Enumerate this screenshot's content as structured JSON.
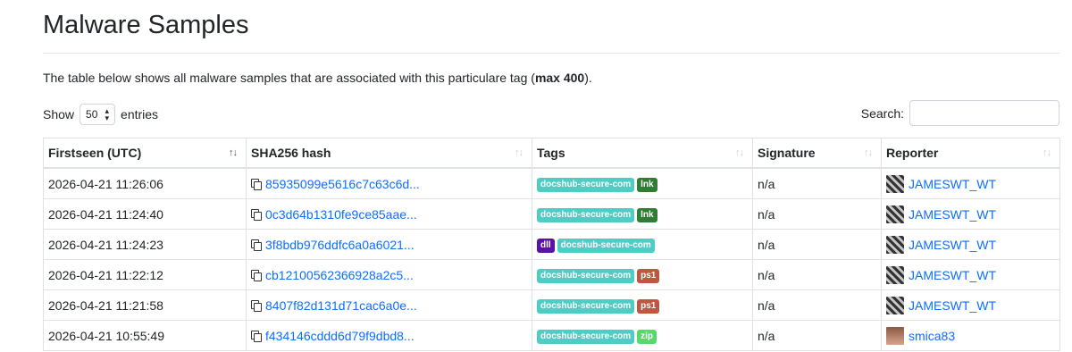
{
  "page": {
    "title": "Malware Samples",
    "intro_text": "The table below shows all malware samples that are associated with this particulare tag (",
    "intro_bold": "max 400",
    "intro_end": ")."
  },
  "controls": {
    "show_label": "Show",
    "page_size": "50",
    "entries_label": "entries",
    "search_label": "Search:",
    "search_value": ""
  },
  "table": {
    "columns": [
      "Firstseen (UTC)",
      "SHA256 hash",
      "Tags",
      "Signature",
      "Reporter"
    ],
    "rows": [
      {
        "firstseen": "2026-04-21 11:26:06",
        "hash": "85935099e5616c7c63c6d...",
        "tags": [
          "docshub-secure-com",
          "lnk"
        ],
        "signature": "n/a",
        "reporter": "JAMESWT_WT",
        "avatar": "a"
      },
      {
        "firstseen": "2026-04-21 11:24:40",
        "hash": "0c3d64b1310fe9ce85aae...",
        "tags": [
          "docshub-secure-com",
          "lnk"
        ],
        "signature": "n/a",
        "reporter": "JAMESWT_WT",
        "avatar": "a"
      },
      {
        "firstseen": "2026-04-21 11:24:23",
        "hash": "3f8bdb976ddfc6a0a6021...",
        "tags": [
          "dll",
          "docshub-secure-com"
        ],
        "signature": "n/a",
        "reporter": "JAMESWT_WT",
        "avatar": "a"
      },
      {
        "firstseen": "2026-04-21 11:22:12",
        "hash": "cb12100562366928a2c5...",
        "tags": [
          "docshub-secure-com",
          "ps1"
        ],
        "signature": "n/a",
        "reporter": "JAMESWT_WT",
        "avatar": "a"
      },
      {
        "firstseen": "2026-04-21 11:21:58",
        "hash": "8407f82d131d71cac6a0e...",
        "tags": [
          "docshub-secure-com",
          "ps1"
        ],
        "signature": "n/a",
        "reporter": "JAMESWT_WT",
        "avatar": "a"
      },
      {
        "firstseen": "2026-04-21 10:55:49",
        "hash": "f434146cddd6d79f9dbd8...",
        "tags": [
          "docshub-secure-com",
          "zip"
        ],
        "signature": "n/a",
        "reporter": "smica83",
        "avatar": "b"
      }
    ]
  },
  "tag_colors": {
    "docshub-secure-com": "#4ecdc4",
    "lnk": "#2e7d32",
    "dll": "#5a12a8",
    "ps1": "#c0563f",
    "zip": "#58d86a"
  },
  "icons": {
    "copy": "copy-icon",
    "sort": "sort-icon",
    "select": "updown-icon",
    "avatar": "reporter-avatar"
  }
}
